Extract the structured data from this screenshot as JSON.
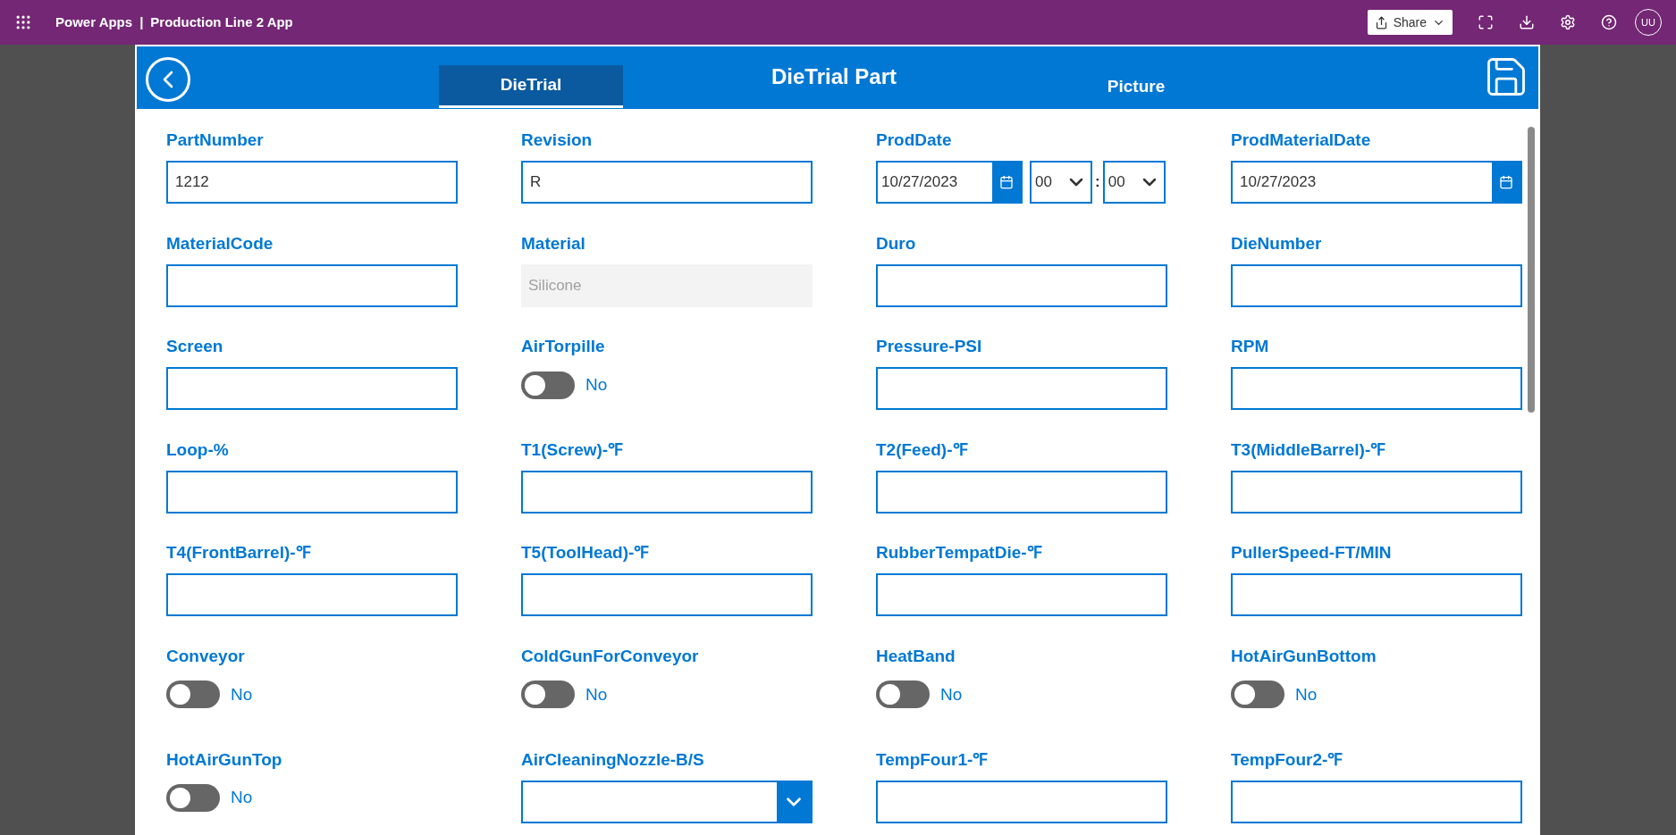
{
  "top_bar": {
    "app_name": "Power Apps",
    "separator": "|",
    "title": "Production Line 2 App",
    "share": "Share",
    "avatar": "UU"
  },
  "header": {
    "title": "DieTrial Part",
    "tabs": [
      {
        "label": "DieTrial",
        "selected": true
      },
      {
        "label": "Picture",
        "selected": false
      }
    ]
  },
  "fields": [
    {
      "kind": "text",
      "label": "PartNumber",
      "value": "1212"
    },
    {
      "kind": "text",
      "label": "Revision",
      "value": "R"
    },
    {
      "kind": "datetime",
      "label": "ProdDate",
      "value": "10/27/2023",
      "hour": "00",
      "colon": ":",
      "minute": "00"
    },
    {
      "kind": "date",
      "label": "ProdMaterialDate",
      "value": "10/27/2023"
    },
    {
      "kind": "text",
      "label": "MaterialCode"
    },
    {
      "kind": "disabled",
      "label": "Material",
      "value": "Silicone"
    },
    {
      "kind": "text",
      "label": "Duro"
    },
    {
      "kind": "text",
      "label": "DieNumber"
    },
    {
      "kind": "text",
      "label": "Screen"
    },
    {
      "kind": "toggle",
      "label": "AirTorpille",
      "on": false,
      "state": "No"
    },
    {
      "kind": "text",
      "label": "Pressure-PSI"
    },
    {
      "kind": "text",
      "label": "RPM"
    },
    {
      "kind": "text",
      "label": "Loop-%"
    },
    {
      "kind": "text",
      "label": "T1(Screw)-℉"
    },
    {
      "kind": "text",
      "label": "T2(Feed)-℉"
    },
    {
      "kind": "text",
      "label": "T3(MiddleBarrel)-℉"
    },
    {
      "kind": "text",
      "label": "T4(FrontBarrel)-℉"
    },
    {
      "kind": "text",
      "label": "T5(ToolHead)-℉"
    },
    {
      "kind": "text",
      "label": "RubberTempatDie-℉"
    },
    {
      "kind": "text",
      "label": "PullerSpeed-FT/MIN"
    },
    {
      "kind": "toggle",
      "label": "Conveyor",
      "on": false,
      "state": "No"
    },
    {
      "kind": "toggle",
      "label": "ColdGunForConveyor",
      "on": false,
      "state": "No"
    },
    {
      "kind": "toggle",
      "label": "HeatBand",
      "on": false,
      "state": "No"
    },
    {
      "kind": "toggle",
      "label": "HotAirGunBottom",
      "on": false,
      "state": "No"
    },
    {
      "kind": "toggle",
      "label": "HotAirGunTop",
      "on": false,
      "state": "No"
    },
    {
      "kind": "dropdown",
      "label": "AirCleaningNozzle-B/S"
    },
    {
      "kind": "text",
      "label": "TempFour1-℉"
    },
    {
      "kind": "text",
      "label": "TempFour2-℉"
    }
  ]
}
